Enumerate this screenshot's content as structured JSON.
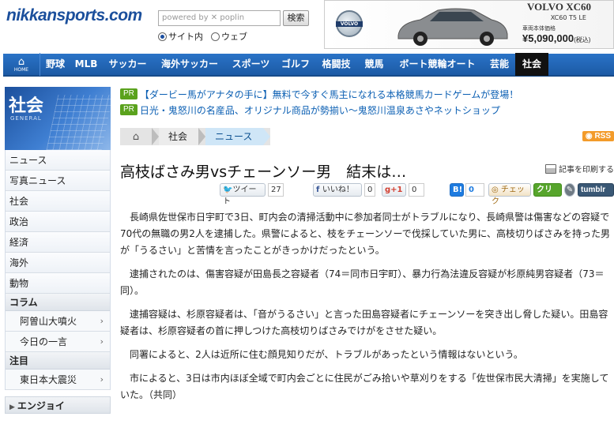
{
  "header": {
    "logo": "nikkansports.com",
    "search_placeholder": "powered by ✕ poplin",
    "search_button": "検索",
    "radio_site": "サイト内",
    "radio_web": "ウェブ"
  },
  "ad": {
    "brand_badge": "VOLVO",
    "title": "VOLVO XC60",
    "model": "XC60 T5 LE",
    "note": "車両本体価格",
    "price": "¥5,090,000",
    "price_suffix": "(税込)"
  },
  "nav": {
    "home_label": "HOME",
    "items": [
      "野球",
      "MLB",
      "サッカー",
      "海外サッカー",
      "スポーツ",
      "ゴルフ",
      "格闘技",
      "競馬",
      "ボート競輪オート",
      "芸能",
      "社会"
    ]
  },
  "sidebar": {
    "banner_kanji": "社会",
    "banner_eng": "GENERAL",
    "items": [
      "ニュース",
      "写真ニュース",
      "社会",
      "政治",
      "経済",
      "海外",
      "動物"
    ],
    "column_head": "コラム",
    "column_items": [
      "阿曽山大噴火",
      "今日の一言"
    ],
    "notice_head": "注目",
    "notice_items": [
      "東日本大震災"
    ],
    "enjoy": "エンジョイ"
  },
  "pr": [
    {
      "badge": "PR",
      "text": "【ダービー馬がアナタの手に】無料で今すぐ馬主になれる本格競馬カードゲームが登場！"
    },
    {
      "badge": "PR",
      "text": "日光・鬼怒川の名産品、オリジナル商品が勢揃い〜鬼怒川温泉あさやネットショップ"
    }
  ],
  "breadcrumb": {
    "items": [
      "社会",
      "ニュース"
    ],
    "rss": "RSS"
  },
  "article": {
    "title": "高枝ばさみ男vsチェーンソー男　結末は…",
    "print_label": "記事を印刷する",
    "social": {
      "tweet": "ツイート",
      "tweet_count": "27",
      "fb_like": "いいね！",
      "fb_count": "0",
      "gplus": "+1",
      "gplus_count": "0",
      "hatena": "B!",
      "hatena_count": "0",
      "mixi": "チェック",
      "clip": "クリップ",
      "tumblr": "tumblr"
    },
    "paragraphs": [
      "長崎県佐世保市日宇町で3日、町内会の清掃活動中に参加者同士がトラブルになり、長崎県警は傷害などの容疑で70代の無職の男2人を逮捕した。県警によると、枝をチェーンソーで伐採していた男に、高枝切りばさみを持った男が「うるさい」と苦情を言ったことがきっかけだったという。",
      "逮捕されたのは、傷害容疑が田島長之容疑者（74＝同市日宇町）、暴力行為法違反容疑が杉原純男容疑者（73＝同）。",
      "逮捕容疑は、杉原容疑者は、「音がうるさい」と言った田島容疑者にチェーンソーを突き出し脅した疑い。田島容疑者は、杉原容疑者の首に押しつけた高枝切りばさみでけがをさせた疑い。",
      "同署によると、2人は近所に住む顔見知りだが、トラブルがあったという情報はないという。",
      "市によると、3日は市内ほぼ全域で町内会ごとに住民がごみ拾いや草刈りをする「佐世保市民大清掃」を実施していた。（共同）"
    ]
  }
}
